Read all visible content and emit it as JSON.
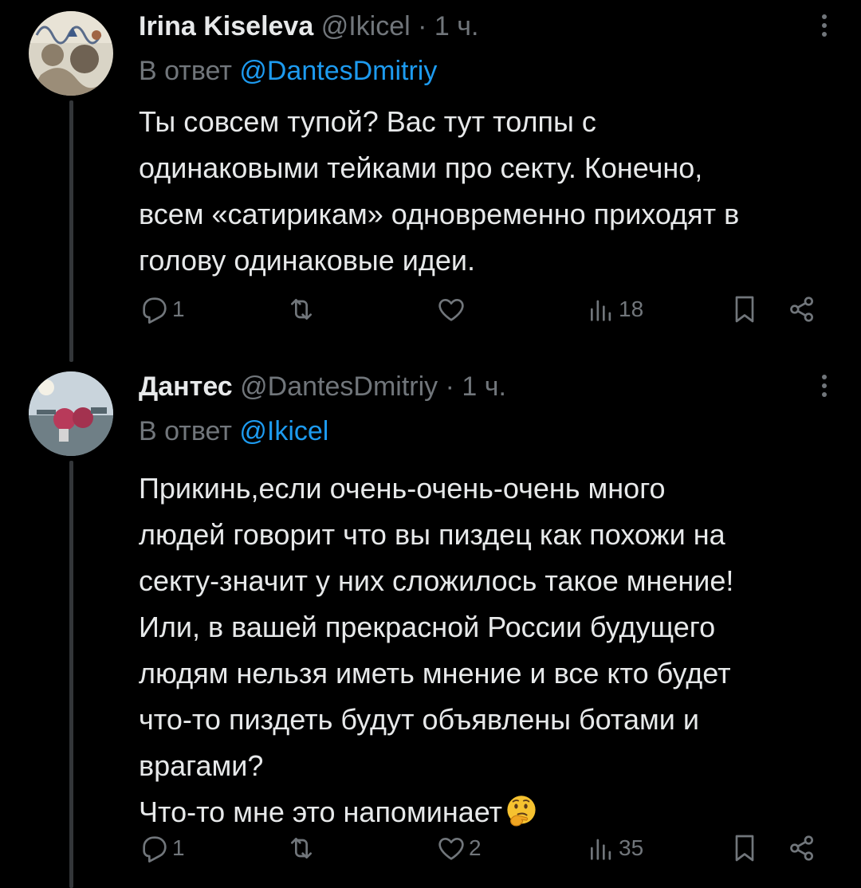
{
  "tweets": [
    {
      "author_name": "Irina Kiseleva",
      "author_handle": "@Ikicel",
      "separator": "·",
      "time": "1 ч.",
      "reply_prefix": "В ответ",
      "reply_to": "@DantesDmitriy",
      "text_lines": [
        "Ты совсем тупой? Вас тут толпы с",
        "одинаковыми тейками про секту. Конечно,",
        "всем «сатирикам» одновременно приходят в",
        "голову одинаковые идеи."
      ],
      "replies": "1",
      "retweets": "",
      "likes": "",
      "views": "18"
    },
    {
      "author_name": "Дантес",
      "author_handle": "@DantesDmitriy",
      "separator": "·",
      "time": "1 ч.",
      "reply_prefix": "В ответ",
      "reply_to": "@Ikicel",
      "text_lines": [
        "Прикинь,если очень-очень-очень много",
        "людей говорит что вы пиздец как похожи на",
        "секту-значит у них сложилось такое мнение!",
        "Или, в вашей прекрасной России будущего",
        "людям нельзя иметь мнение и все кто будет",
        "что-то пиздеть будут объявлены ботами и",
        "врагами?",
        "Что-то мне это напоминает"
      ],
      "replies": "1",
      "retweets": "",
      "likes": "2",
      "views": "35"
    }
  ],
  "colors": {
    "background": "#000000",
    "text_primary": "#e7e9ea",
    "text_secondary": "#71767b",
    "accent": "#1d9bf0",
    "thread_line": "#333639"
  },
  "icons": {
    "reply": "reply-icon",
    "retweet": "retweet-icon",
    "like": "heart-icon",
    "views": "views-icon",
    "bookmark": "bookmark-icon",
    "share": "share-icon",
    "more": "more-dots-icon",
    "emoji": "thinking-face-emoji"
  }
}
